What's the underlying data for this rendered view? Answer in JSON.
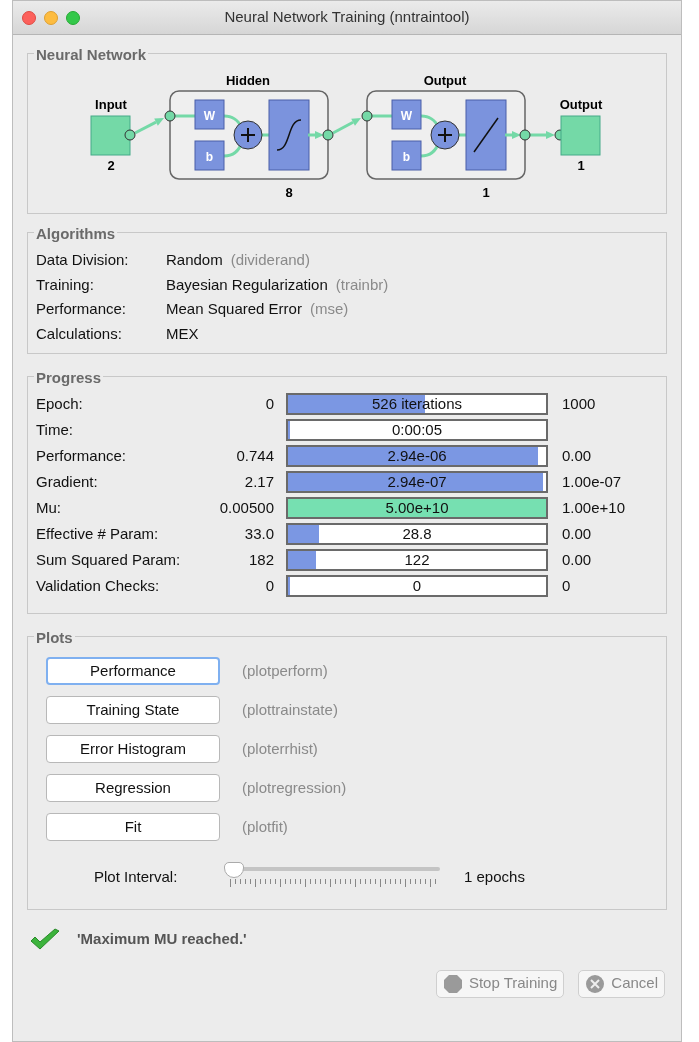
{
  "window": {
    "title": "Neural Network Training (nntraintool)"
  },
  "network": {
    "title": "Neural Network",
    "input": {
      "label": "Input",
      "size": "2"
    },
    "layers": [
      {
        "title": "Hidden",
        "weight": "W",
        "bias": "b",
        "size": "8",
        "kind": "sigmoid"
      },
      {
        "title": "Output",
        "weight": "W",
        "bias": "b",
        "size": "1",
        "kind": "linear"
      }
    ],
    "output": {
      "label": "Output",
      "size": "1"
    }
  },
  "algorithms": {
    "title": "Algorithms",
    "rows": [
      {
        "label": "Data Division:",
        "value": "Random",
        "function": "(dividerand)"
      },
      {
        "label": "Training:",
        "value": "Bayesian Regularization",
        "function": "(trainbr)"
      },
      {
        "label": "Performance:",
        "value": "Mean Squared Error",
        "function": "(mse)"
      },
      {
        "label": "Calculations:",
        "value": "MEX"
      }
    ]
  },
  "progress": {
    "title": "Progress",
    "rows": [
      {
        "label": "Epoch:",
        "start": "0",
        "bar_text": "526 iterations",
        "end": "1000",
        "level": 0.53,
        "color": "#7b97e3"
      },
      {
        "label": "Time:",
        "bar_text": "0:00:05",
        "level": 0,
        "color": "#7b97e3"
      },
      {
        "label": "Performance:",
        "start": "0.744",
        "bar_text": "2.94e-06",
        "end": "0.00",
        "level": 0.97,
        "color": "#7b97e3"
      },
      {
        "label": "Gradient:",
        "start": "2.17",
        "bar_text": "2.94e-07",
        "end": "1.00e-07",
        "level": 0.99,
        "color": "#7b97e3"
      },
      {
        "label": "Mu:",
        "start": "0.00500",
        "bar_text": "5.00e+10",
        "end": "1.00e+10",
        "level": 1,
        "color": "#76e0b1"
      },
      {
        "label": "Effective # Param:",
        "start": "33.0",
        "bar_text": "28.8",
        "end": "0.00",
        "level": 0.12,
        "color": "#7b97e3"
      },
      {
        "label": "Sum Squared Param:",
        "start": "182",
        "bar_text": "122",
        "end": "0.00",
        "level": 0.11,
        "color": "#7b97e3"
      },
      {
        "label": "Validation Checks:",
        "start": "0",
        "bar_text": "0",
        "end": "0",
        "level": 0,
        "color": "#7b97e3"
      }
    ]
  },
  "plots": {
    "title": "Plots",
    "buttons": [
      {
        "label": "Performance",
        "function": "(plotperform)",
        "focused": true
      },
      {
        "label": "Training State",
        "function": "(plottrainstate)",
        "focused": false
      },
      {
        "label": "Error Histogram",
        "function": "(ploterrhist)",
        "focused": false
      },
      {
        "label": "Regression",
        "function": "(plotregression)",
        "focused": false
      },
      {
        "label": "Fit",
        "function": "(plotfit)",
        "focused": false
      }
    ],
    "interval": {
      "label": "Plot Interval:",
      "level": 0,
      "reading": "1 epochs"
    }
  },
  "status": {
    "kind": "success",
    "message": "'Maximum MU reached.'"
  },
  "buttons": [
    {
      "kind": "stop",
      "label": "Stop Training",
      "disabled": true
    },
    {
      "kind": "cancel",
      "label": "Cancel",
      "disabled": true
    }
  ]
}
